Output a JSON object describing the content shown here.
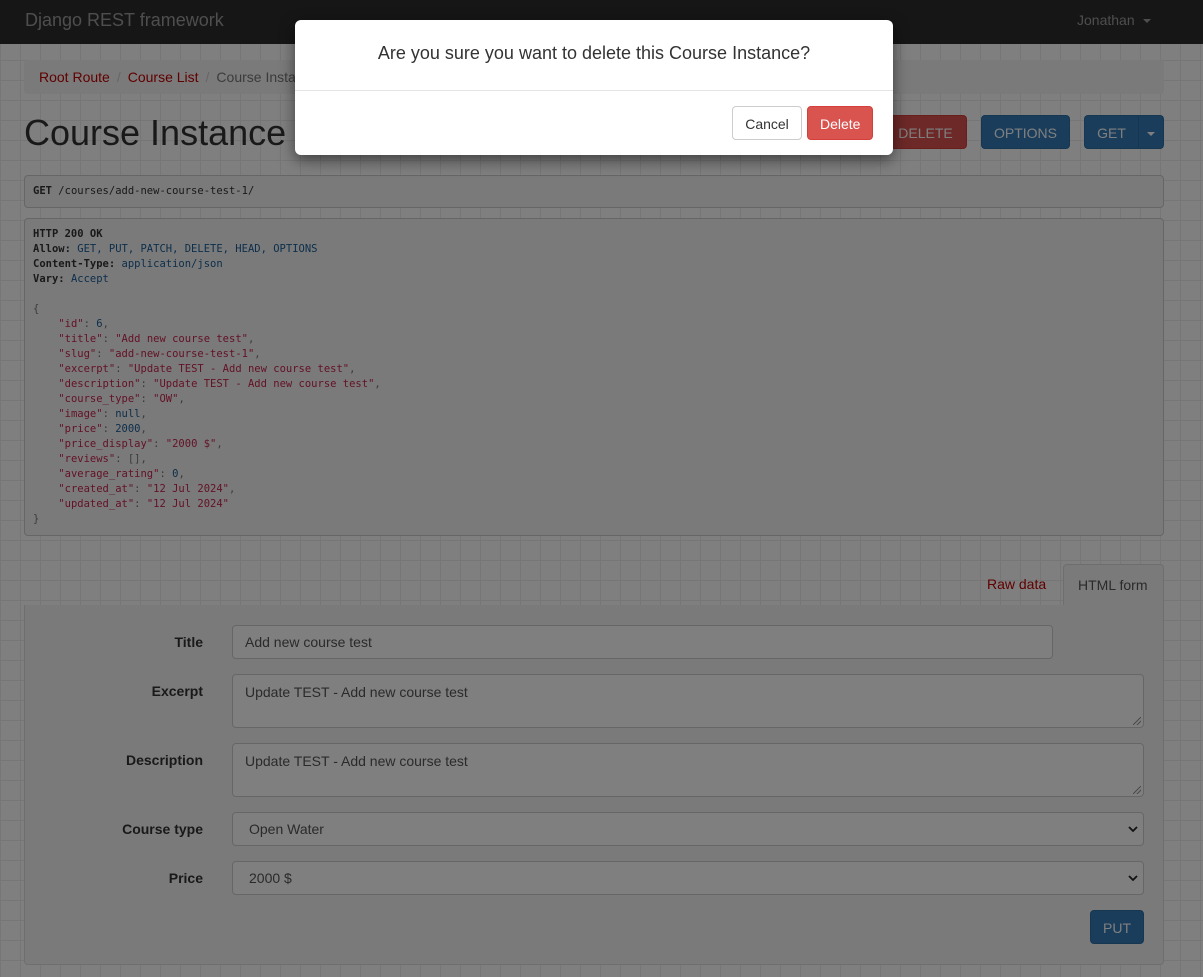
{
  "navbar": {
    "brand": "Django REST framework",
    "user": "Jonathan"
  },
  "breadcrumb": {
    "items": [
      "Root Route",
      "Course List"
    ],
    "active": "Course Instance"
  },
  "header": {
    "title": "Course Instance",
    "delete_label": "DELETE",
    "options_label": "OPTIONS",
    "get_label": "GET"
  },
  "request": {
    "method": "GET",
    "path": "/courses/add-new-course-test-1/"
  },
  "response": {
    "status": "HTTP 200 OK",
    "headers": [
      {
        "name": "Allow:",
        "value": "GET, PUT, PATCH, DELETE, HEAD, OPTIONS"
      },
      {
        "name": "Content-Type:",
        "value": "application/json"
      },
      {
        "name": "Vary:",
        "value": "Accept"
      }
    ],
    "body": [
      {
        "key": "\"id\"",
        "value": "6",
        "kind": "num"
      },
      {
        "key": "\"title\"",
        "value": "\"Add new course test\"",
        "kind": "str"
      },
      {
        "key": "\"slug\"",
        "value": "\"add-new-course-test-1\"",
        "kind": "str"
      },
      {
        "key": "\"excerpt\"",
        "value": "\"Update TEST - Add new course test\"",
        "kind": "str"
      },
      {
        "key": "\"description\"",
        "value": "\"Update TEST - Add new course test\"",
        "kind": "str"
      },
      {
        "key": "\"course_type\"",
        "value": "\"OW\"",
        "kind": "str"
      },
      {
        "key": "\"image\"",
        "value": "null",
        "kind": "num"
      },
      {
        "key": "\"price\"",
        "value": "2000",
        "kind": "num"
      },
      {
        "key": "\"price_display\"",
        "value": "\"2000 $\"",
        "kind": "str"
      },
      {
        "key": "\"reviews\"",
        "value": "[]",
        "kind": "pun"
      },
      {
        "key": "\"average_rating\"",
        "value": "0",
        "kind": "num"
      },
      {
        "key": "\"created_at\"",
        "value": "\"12 Jul 2024\"",
        "kind": "str"
      },
      {
        "key": "\"updated_at\"",
        "value": "\"12 Jul 2024\"",
        "kind": "str"
      }
    ]
  },
  "tabs": {
    "raw": "Raw data",
    "html": "HTML form"
  },
  "form": {
    "title_label": "Title",
    "title_value": "Add new course test",
    "excerpt_label": "Excerpt",
    "excerpt_value": "Update TEST - Add new course test",
    "description_label": "Description",
    "description_value": "Update TEST - Add new course test",
    "course_type_label": "Course type",
    "course_type_value": "Open Water",
    "price_label": "Price",
    "price_value": "2000 $",
    "put_label": "PUT"
  },
  "modal": {
    "question": "Are you sure you want to delete this Course Instance?",
    "cancel_label": "Cancel",
    "delete_label": "Delete"
  }
}
